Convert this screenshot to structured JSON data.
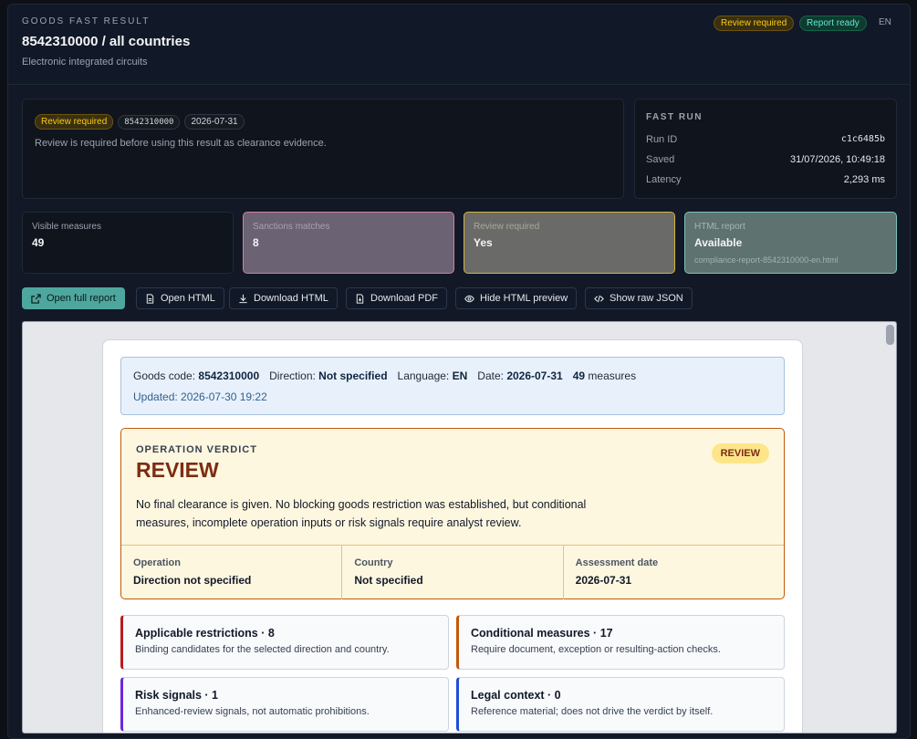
{
  "header": {
    "eyebrow": "GOODS FAST RESULT",
    "title": "8542310000 / all countries",
    "subtitle": "Electronic integrated circuits",
    "badges": {
      "review": "Review required",
      "report": "Report ready",
      "lang": "EN"
    }
  },
  "summary": {
    "chips": {
      "status": "Review required",
      "code": "8542310000",
      "date": "2026-07-31"
    },
    "note": "Review is required before using this result as clearance evidence."
  },
  "fast_run": {
    "title": "FAST RUN",
    "rows": [
      {
        "label": "Run ID",
        "value": "c1c6485b"
      },
      {
        "label": "Saved",
        "value": "31/07/2026, 10:49:18"
      },
      {
        "label": "Latency",
        "value": "2,293 ms"
      }
    ]
  },
  "metrics": [
    {
      "label": "Visible measures",
      "value": "49"
    },
    {
      "label": "Sanctions matches",
      "value": "8"
    },
    {
      "label": "Review required",
      "value": "Yes"
    },
    {
      "label": "HTML report",
      "value": "Available",
      "sub": "compliance-report-8542310000-en.html"
    }
  ],
  "toolbar": {
    "open_full": "Open full report",
    "open_html": "Open HTML",
    "download_html": "Download HTML",
    "download_pdf": "Download PDF",
    "hide_preview": "Hide HTML preview",
    "raw_json": "Show raw JSON"
  },
  "report": {
    "info": {
      "goods_code_label": "Goods code:",
      "goods_code": "8542310000",
      "direction_label": "Direction:",
      "direction": "Not specified",
      "language_label": "Language:",
      "language": "EN",
      "date_label": "Date:",
      "date": "2026-07-31",
      "measures_count": "49",
      "measures_label": "measures",
      "updated": "Updated: 2026-07-30 19:22"
    },
    "verdict": {
      "eyebrow": "OPERATION VERDICT",
      "title": "REVIEW",
      "pill": "REVIEW",
      "text": "No final clearance is given. No blocking goods restriction was established, but conditional measures, incomplete operation inputs or risk signals require analyst review.",
      "cells": [
        {
          "label": "Operation",
          "value": "Direction not specified"
        },
        {
          "label": "Country",
          "value": "Not specified"
        },
        {
          "label": "Assessment date",
          "value": "2026-07-31"
        }
      ]
    },
    "categories": [
      {
        "title": "Applicable restrictions · 8",
        "desc": "Binding candidates for the selected direction and country.",
        "color": "#b91c1c"
      },
      {
        "title": "Conditional measures · 17",
        "desc": "Require document, exception or resulting-action checks.",
        "color": "#c2590b"
      },
      {
        "title": "Risk signals · 1",
        "desc": "Enhanced-review signals, not automatic prohibitions.",
        "color": "#6d28d9"
      },
      {
        "title": "Legal context · 0",
        "desc": "Reference material; does not drive the verdict by itself.",
        "color": "#1d4ed8"
      }
    ]
  }
}
